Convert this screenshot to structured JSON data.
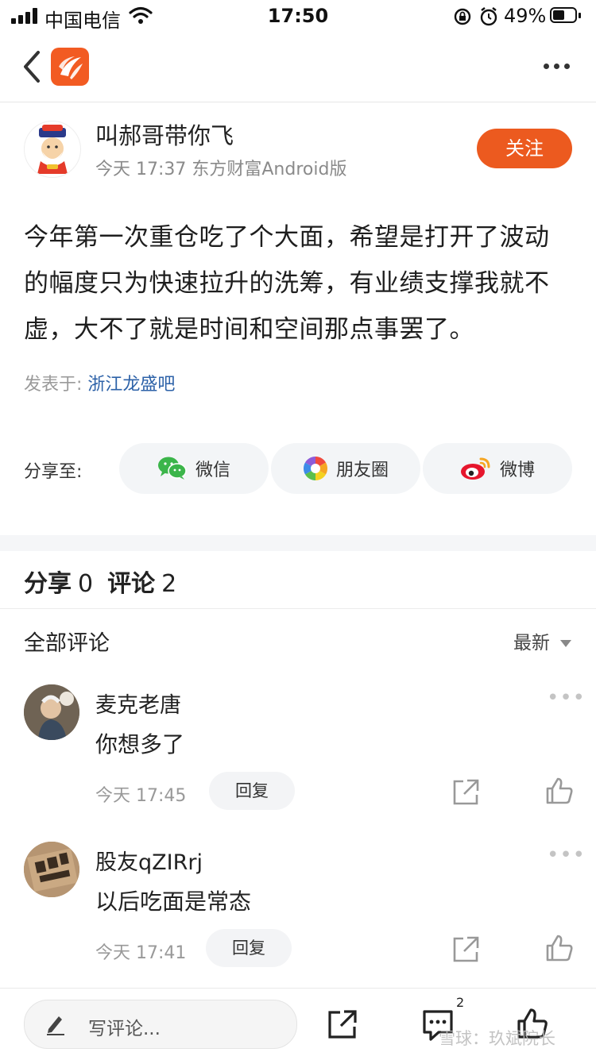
{
  "status_bar": {
    "carrier": "中国电信",
    "time": "17:50",
    "battery": "49%"
  },
  "nav": {
    "back_icon": "chevron-left-icon",
    "logo_icon": "eastmoney-logo-icon",
    "more_icon": "more-horizontal-icon"
  },
  "post": {
    "author_name": "叫郝哥带你飞",
    "meta": "今天 17:37 东方财富Android版",
    "follow_label": "关注",
    "body": "今年第一次重仓吃了个大面，希望是打开了波动的幅度只为快速拉升的洗筹，有业绩支撑我就不虚，大不了就是时间和空间那点事罢了。",
    "posted_in_label": "发表于:",
    "forum": "浙江龙盛吧"
  },
  "share": {
    "label": "分享至:",
    "targets": [
      {
        "label": "微信",
        "icon": "wechat-icon"
      },
      {
        "label": "朋友圈",
        "icon": "moments-icon"
      },
      {
        "label": "微博",
        "icon": "weibo-icon"
      }
    ]
  },
  "stats": {
    "share_label": "分享",
    "share_count": "0",
    "comment_label": "评论",
    "comment_count": "2"
  },
  "comments_header": {
    "title": "全部评论",
    "sort": "最新"
  },
  "comments": [
    {
      "name": "麦克老唐",
      "text": "你想多了",
      "time": "今天 17:45",
      "reply_label": "回复"
    },
    {
      "name": "股友qZIRrj",
      "text": "以后吃面是常态",
      "time": "今天 17:41",
      "reply_label": "回复"
    }
  ],
  "bottom_bar": {
    "write_placeholder": "写评论...",
    "comment_badge": "2"
  },
  "watermark": "雪球：玖斌院长",
  "colors": {
    "accent": "#ec5a1f",
    "link": "#2d62a8"
  }
}
